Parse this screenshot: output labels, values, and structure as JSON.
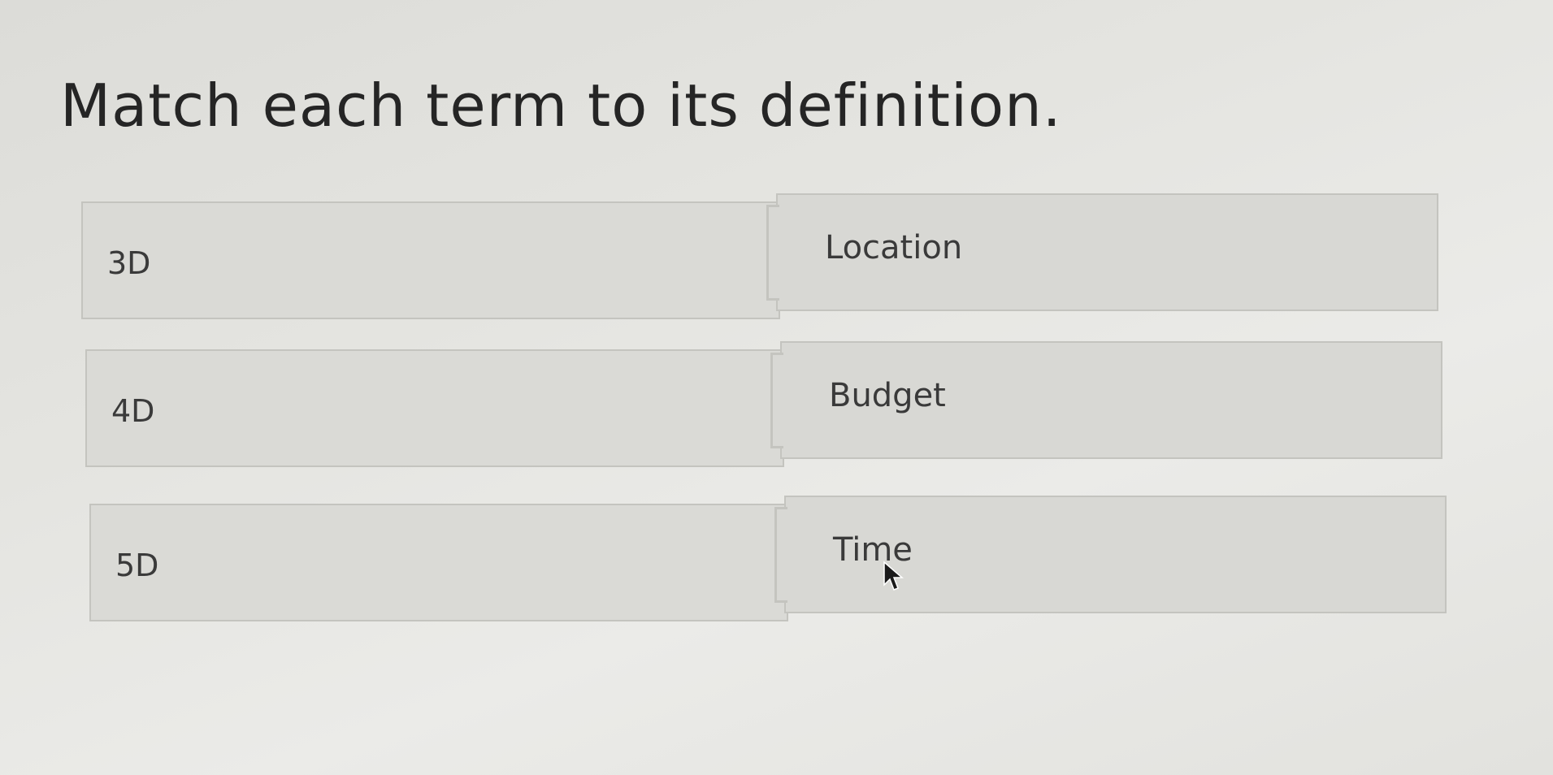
{
  "question": {
    "title": "Match each term to its definition."
  },
  "pairs": [
    {
      "term": "3D",
      "definition": "Location"
    },
    {
      "term": "4D",
      "definition": "Budget"
    },
    {
      "term": "5D",
      "definition": "Time"
    }
  ],
  "colors": {
    "background": "#e4e4e0",
    "box_fill": "#d8d8d4",
    "box_border": "#c4c4bf",
    "text": "#3a3a3a"
  },
  "cursor": {
    "icon": "mouse-pointer-icon"
  }
}
